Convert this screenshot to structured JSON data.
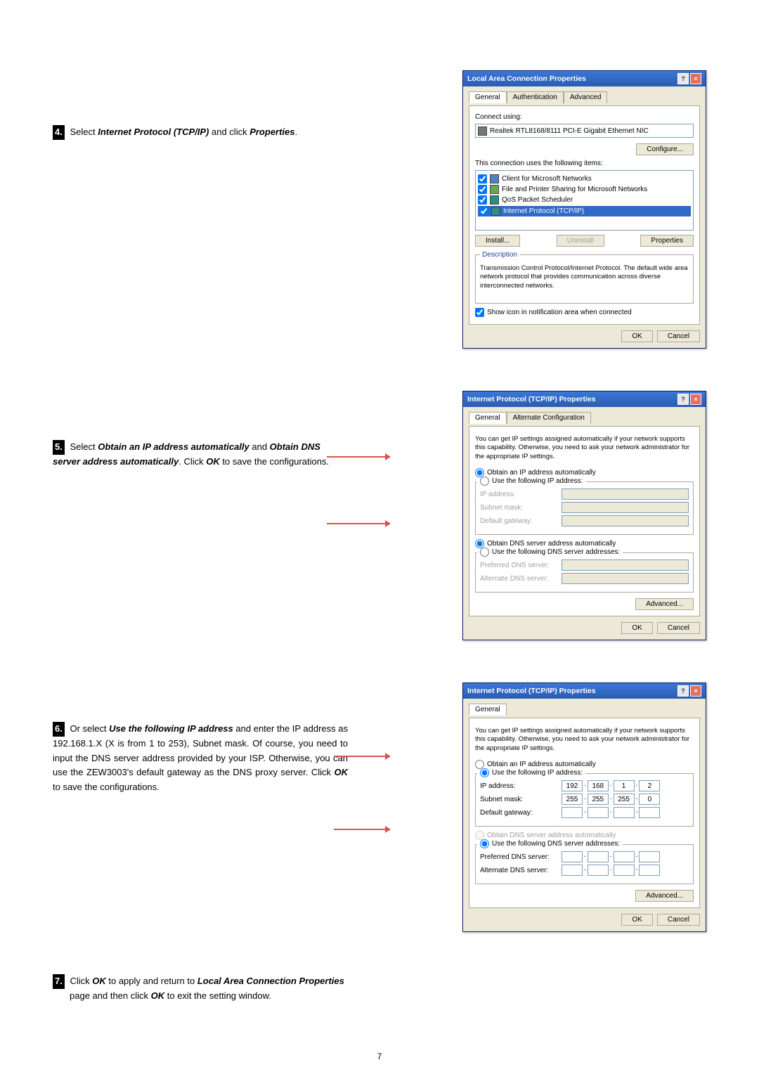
{
  "step4": {
    "num": "4.",
    "text_pre": "Select ",
    "b1": "Internet Protocol (TCP/IP)",
    "text_mid": " and click ",
    "b2": "Properties",
    "text_after": "."
  },
  "step5": {
    "num": "5.",
    "text_pre": "Select ",
    "b1": "Obtain an IP address automatically",
    "text_mid1": " and ",
    "b2": "Obtain DNS server address automatically",
    "text_mid2": ". Click ",
    "b3": "OK",
    "text_after": " to save the configurations."
  },
  "step6": {
    "num": "6.",
    "text_pre": "Or select ",
    "b1": "Use the following IP address",
    "text_body": " and enter the IP address as 192.168.1.X (X is from 1 to 253), Subnet mask. Of course, you need to input the DNS server address provided by your ISP. Otherwise, you can use the ZEW3003's default gateway as the DNS proxy server. Click ",
    "b2": "OK",
    "text_after": " to save the configurations."
  },
  "step7": {
    "num": "7.",
    "text_pre": "Click ",
    "b1": "OK",
    "text_mid1": " to apply and return to ",
    "b2": "Local Area Connection Properties",
    "text_mid2": " page and then click ",
    "b3": "OK",
    "text_after": " to exit the setting window."
  },
  "dlg1": {
    "title": "Local Area Connection Properties",
    "tab_general": "General",
    "tab_auth": "Authentication",
    "tab_adv": "Advanced",
    "connect_using": "Connect using:",
    "adapter": "Realtek RTL8168/8111 PCI-E Gigabit Ethernet NIC",
    "configure_btn": "Configure...",
    "uses_items": "This connection uses the following items:",
    "item1": "Client for Microsoft Networks",
    "item2": "File and Printer Sharing for Microsoft Networks",
    "item3": "QoS Packet Scheduler",
    "item4": "Internet Protocol (TCP/IP)",
    "install_btn": "Install...",
    "uninstall_btn": "Uninstall",
    "properties_btn": "Properties",
    "description_legend": "Description",
    "description_text": "Transmission Control Protocol/Internet Protocol. The default wide area network protocol that provides communication across diverse interconnected networks.",
    "show_icon": "Show icon in notification area when connected",
    "ok": "OK",
    "cancel": "Cancel"
  },
  "dlg2": {
    "title": "Internet Protocol (TCP/IP) Properties",
    "tab_general": "General",
    "tab_alt": "Alternate Configuration",
    "intro": "You can get IP settings assigned automatically if your network supports this capability. Otherwise, you need to ask your network administrator for the appropriate IP settings.",
    "obtain_ip_auto": "Obtain an IP address automatically",
    "use_following_ip": "Use the following IP address:",
    "ip_address": "IP address:",
    "subnet": "Subnet mask:",
    "gateway": "Default gateway:",
    "obtain_dns_auto": "Obtain DNS server address automatically",
    "use_following_dns": "Use the following DNS server addresses:",
    "pref_dns": "Preferred DNS server:",
    "alt_dns": "Alternate DNS server:",
    "advanced": "Advanced...",
    "ok": "OK",
    "cancel": "Cancel"
  },
  "dlg3": {
    "title": "Internet Protocol (TCP/IP) Properties",
    "tab_general": "General",
    "intro": "You can get IP settings assigned automatically if your network supports this capability. Otherwise, you need to ask your network administrator for the appropriate IP settings.",
    "obtain_ip_auto": "Obtain an IP address automatically",
    "use_following_ip": "Use the following IP address:",
    "ip_address": "IP address:",
    "ip_val": [
      "192",
      "168",
      "1",
      "2"
    ],
    "subnet": "Subnet mask:",
    "subnet_val": [
      "255",
      "255",
      "255",
      "0"
    ],
    "gateway": "Default gateway:",
    "gateway_val": [
      ".",
      ".",
      ".",
      ""
    ],
    "obtain_dns_auto": "Obtain DNS server address automatically",
    "use_following_dns": "Use the following DNS server addresses:",
    "pref_dns": "Preferred DNS server:",
    "alt_dns": "Alternate DNS server:",
    "advanced": "Advanced...",
    "ok": "OK",
    "cancel": "Cancel"
  },
  "page_number": "7"
}
